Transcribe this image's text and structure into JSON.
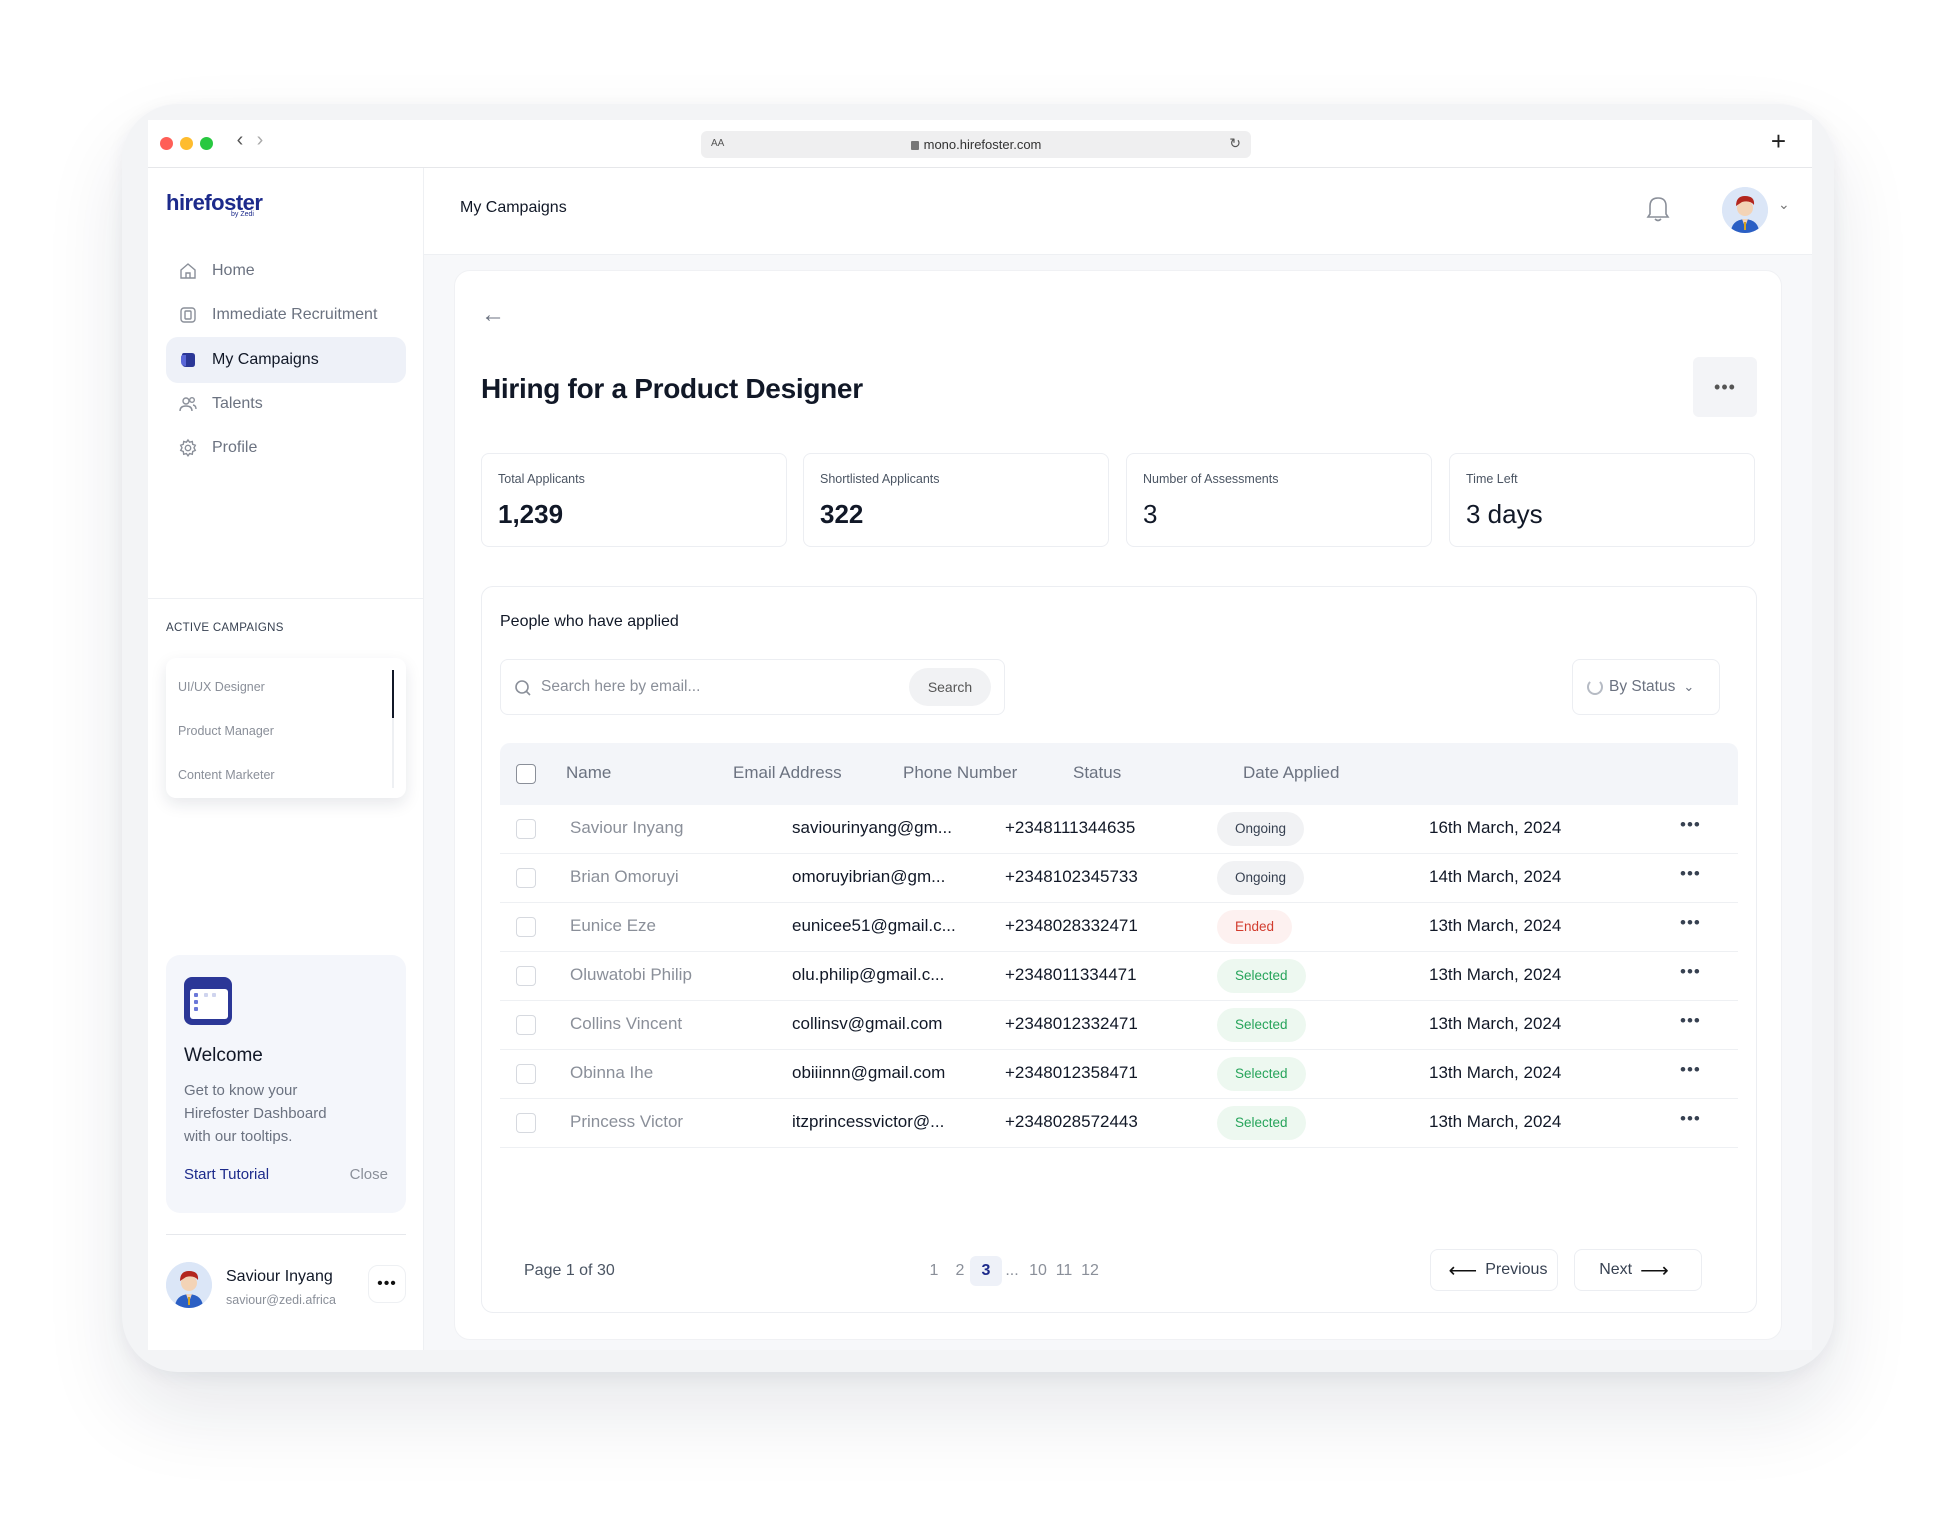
{
  "browser": {
    "url": "mono.hirefoster.com",
    "aa": "AA",
    "new_tab": "+",
    "back": "‹",
    "forward": "›",
    "reload": "↻"
  },
  "brand": {
    "name": "hirefoster",
    "sub": "by Zedi"
  },
  "sidebar": {
    "items": [
      {
        "label": "Home",
        "icon": "home-icon"
      },
      {
        "label": "Immediate Recruitment",
        "icon": "recruitment-icon"
      },
      {
        "label": "My Campaigns",
        "icon": "campaigns-icon",
        "active": true
      },
      {
        "label": "Talents",
        "icon": "users-icon"
      },
      {
        "label": "Profile",
        "icon": "gear-icon"
      }
    ],
    "active_campaigns_title": "ACTIVE CAMPAIGNS",
    "active_campaigns": [
      "UI/UX Designer",
      "Product Manager",
      "Content Marketer"
    ]
  },
  "welcome": {
    "title": "Welcome",
    "text": "Get to know your Hirefoster Dashboard with our tooltips.",
    "start_label": "Start Tutorial",
    "close_label": "Close"
  },
  "user": {
    "name": "Saviour Inyang",
    "email": "saviour@zedi.africa",
    "more": "•••"
  },
  "header": {
    "crumb": "My Campaigns"
  },
  "page": {
    "back": "←",
    "title": "Hiring for a Product Designer",
    "more": "•••"
  },
  "stats": [
    {
      "label": "Total Applicants",
      "value": "1,239"
    },
    {
      "label": "Shortlisted Applicants",
      "value": "322"
    },
    {
      "label": "Number of Assessments",
      "value": "3"
    },
    {
      "label": "Time Left",
      "value": "3 days"
    }
  ],
  "applicants": {
    "title": "People who have applied",
    "search_placeholder": "Search here by email...",
    "search_button": "Search",
    "filter_label": "By Status",
    "columns": [
      "Name",
      "Email Address",
      "Phone Number",
      "Status",
      "Date Applied"
    ],
    "rows": [
      {
        "name": "Saviour Inyang",
        "email": "saviourinyang@gm...",
        "phone": "+2348111344635",
        "status": "Ongoing",
        "date": "16th March, 2024",
        "more": "•••"
      },
      {
        "name": "Brian Omoruyi",
        "email": "omoruyibrian@gm...",
        "phone": "+2348102345733",
        "status": "Ongoing",
        "date": "14th March, 2024",
        "more": "•••"
      },
      {
        "name": "Eunice Eze",
        "email": "eunicee51@gmail.c...",
        "phone": "+2348028332471",
        "status": "Ended",
        "date": "13th March, 2024",
        "more": "•••"
      },
      {
        "name": "Oluwatobi Philip",
        "email": "olu.philip@gmail.c...",
        "phone": "+2348011334471",
        "status": "Selected",
        "date": "13th March, 2024",
        "more": "•••"
      },
      {
        "name": "Collins Vincent",
        "email": "collinsv@gmail.com",
        "phone": "+2348012332471",
        "status": "Selected",
        "date": "13th March, 2024",
        "more": "•••"
      },
      {
        "name": "Obinna Ihe",
        "email": "obiiinnn@gmail.com",
        "phone": "+2348012358471",
        "status": "Selected",
        "date": "13th March, 2024",
        "more": "•••"
      },
      {
        "name": "Princess Victor",
        "email": "itzprincessvictor@...",
        "phone": "+2348028572443",
        "status": "Selected",
        "date": "13th March, 2024",
        "more": "•••"
      }
    ],
    "pagination": {
      "info": "Page 1 of 30",
      "pages": [
        "1",
        "2",
        "3",
        "...",
        "10",
        "11",
        "12"
      ],
      "current": "3",
      "prev_label": "Previous",
      "next_label": "Next",
      "prev_arrow": "⟵",
      "next_arrow": "⟶"
    }
  },
  "colors": {
    "brand": "#1c2a8b",
    "ongoing": "#374151",
    "ended": "#d23c2e",
    "selected": "#26a45a"
  }
}
